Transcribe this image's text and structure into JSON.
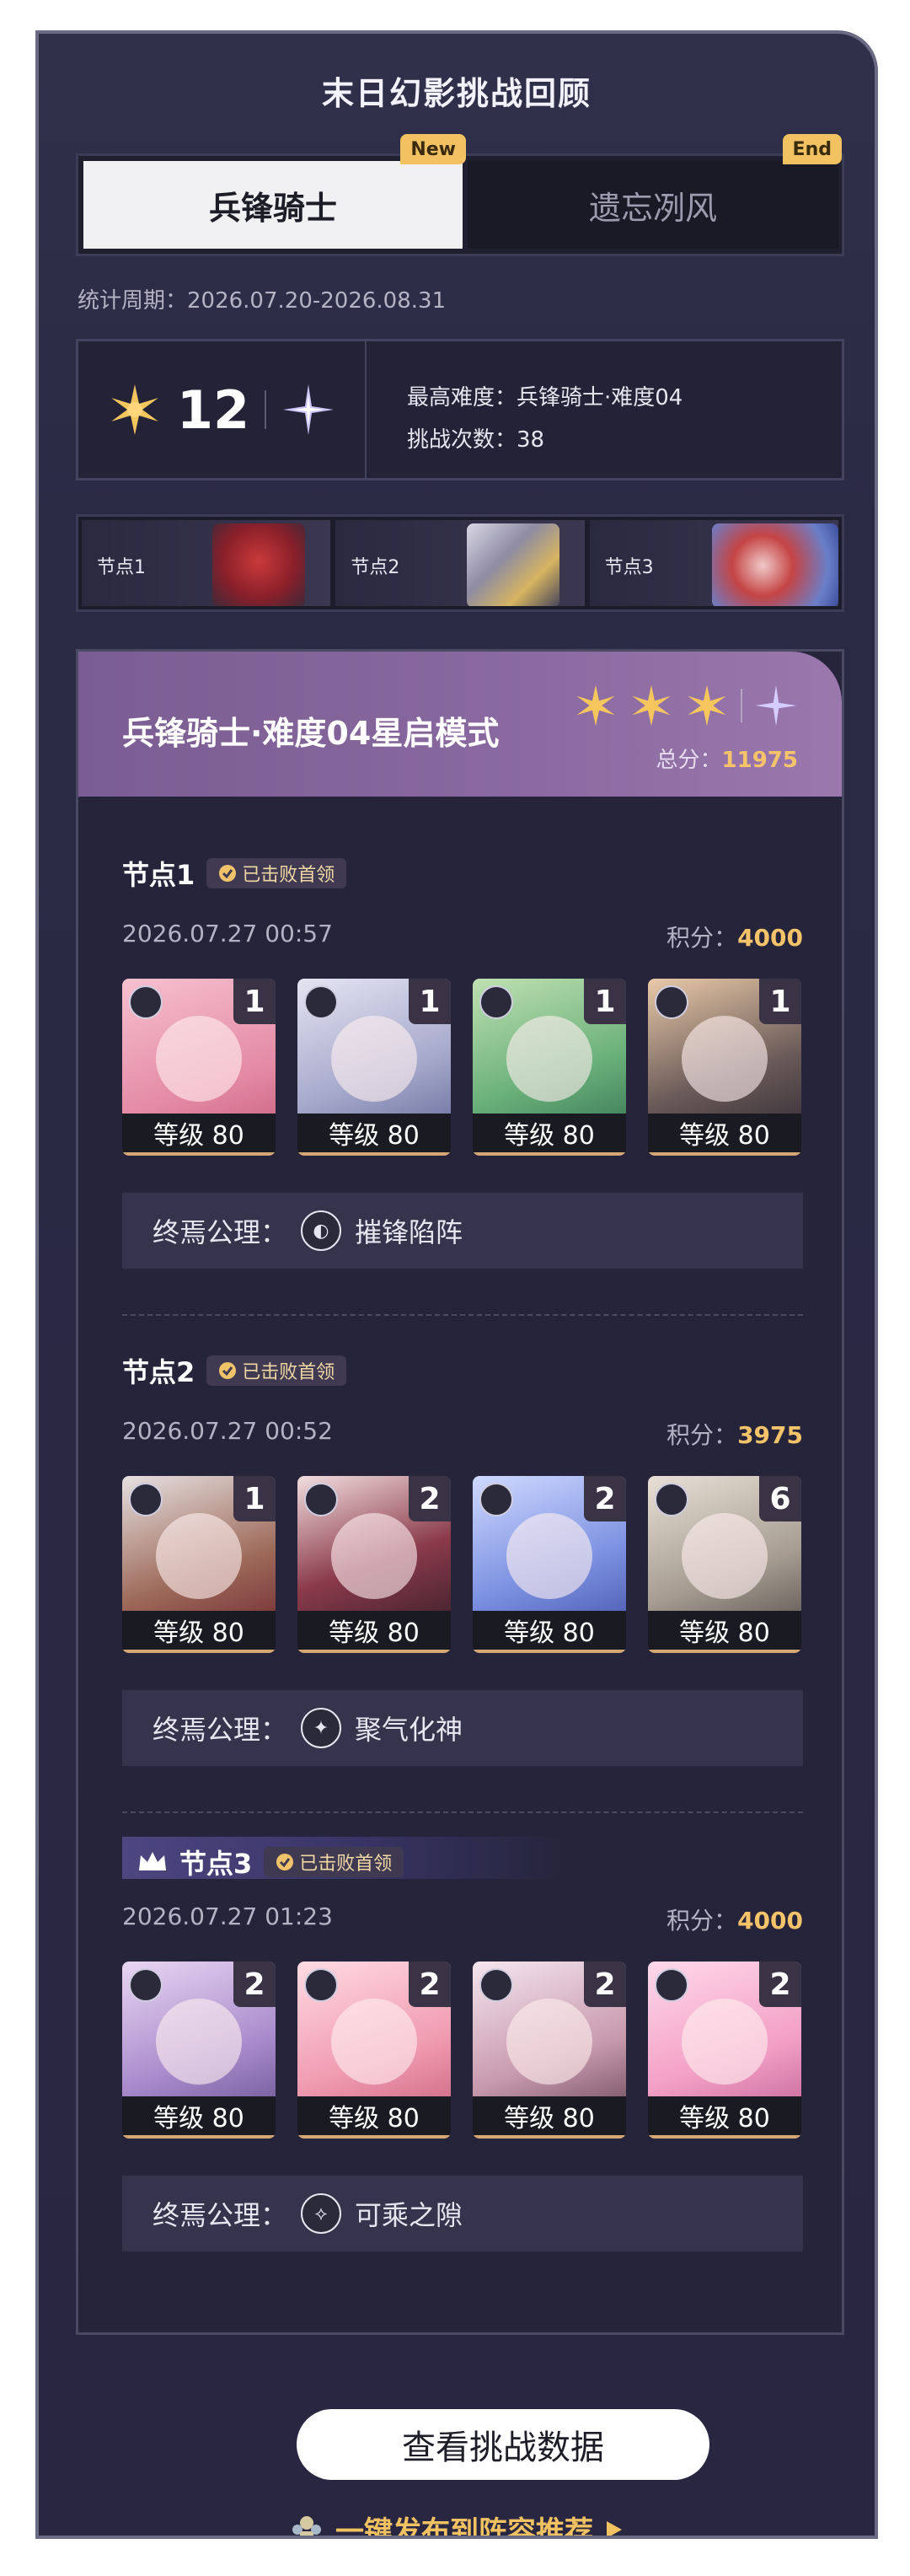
{
  "header": {
    "title": "末日幻影挑战回顾"
  },
  "tabs": [
    {
      "label": "兵锋骑士",
      "badge": "New"
    },
    {
      "label": "遗忘冽风",
      "badge": "End"
    }
  ],
  "period": "统计周期：2026.07.20-2026.08.31",
  "summary": {
    "stars": "12",
    "max_difficulty": "最高难度：兵锋骑士·难度04",
    "attempts": "挑战次数：38"
  },
  "node_strip": [
    "节点1",
    "节点2",
    "节点3"
  ],
  "section": {
    "title": "兵锋骑士·难度04星启模式",
    "total_label": "总分：",
    "total_value": "11975"
  },
  "nodes": [
    {
      "title": "节点1",
      "badge": "已击败首领",
      "time": "2026.07.27 00:57",
      "score_label": "积分：",
      "score": "4000",
      "chars": [
        {
          "count": "1",
          "level": "等级 80"
        },
        {
          "count": "1",
          "level": "等级 80"
        },
        {
          "count": "1",
          "level": "等级 80"
        },
        {
          "count": "1",
          "level": "等级 80"
        }
      ],
      "axiom_label": "终焉公理：",
      "axiom_value": "摧锋陷阵"
    },
    {
      "title": "节点2",
      "badge": "已击败首领",
      "time": "2026.07.27 00:52",
      "score_label": "积分：",
      "score": "3975",
      "chars": [
        {
          "count": "1",
          "level": "等级 80"
        },
        {
          "count": "2",
          "level": "等级 80"
        },
        {
          "count": "2",
          "level": "等级 80"
        },
        {
          "count": "6",
          "level": "等级 80"
        }
      ],
      "axiom_label": "终焉公理：",
      "axiom_value": "聚气化神"
    },
    {
      "title": "节点3",
      "badge": "已击败首领",
      "time": "2026.07.27 01:23",
      "score_label": "积分：",
      "score": "4000",
      "chars": [
        {
          "count": "2",
          "level": "等级 80"
        },
        {
          "count": "2",
          "level": "等级 80"
        },
        {
          "count": "2",
          "level": "等级 80"
        },
        {
          "count": "2",
          "level": "等级 80"
        }
      ],
      "axiom_label": "终焉公理：",
      "axiom_value": "可乘之隙"
    }
  ],
  "actions": {
    "view_data": "查看挑战数据",
    "publish": "一键发布到阵容推荐"
  },
  "colors": {
    "accent_gold": "#f5c46a",
    "panel_bg": "#2a2843",
    "section_head": "#8a6aa0"
  },
  "icons": {
    "sun_star": "gold-starburst-icon",
    "spark_star": "violet-sparkle-icon",
    "crown": "crown-icon",
    "check": "check-circle-icon",
    "play": "play-arrow-icon"
  }
}
